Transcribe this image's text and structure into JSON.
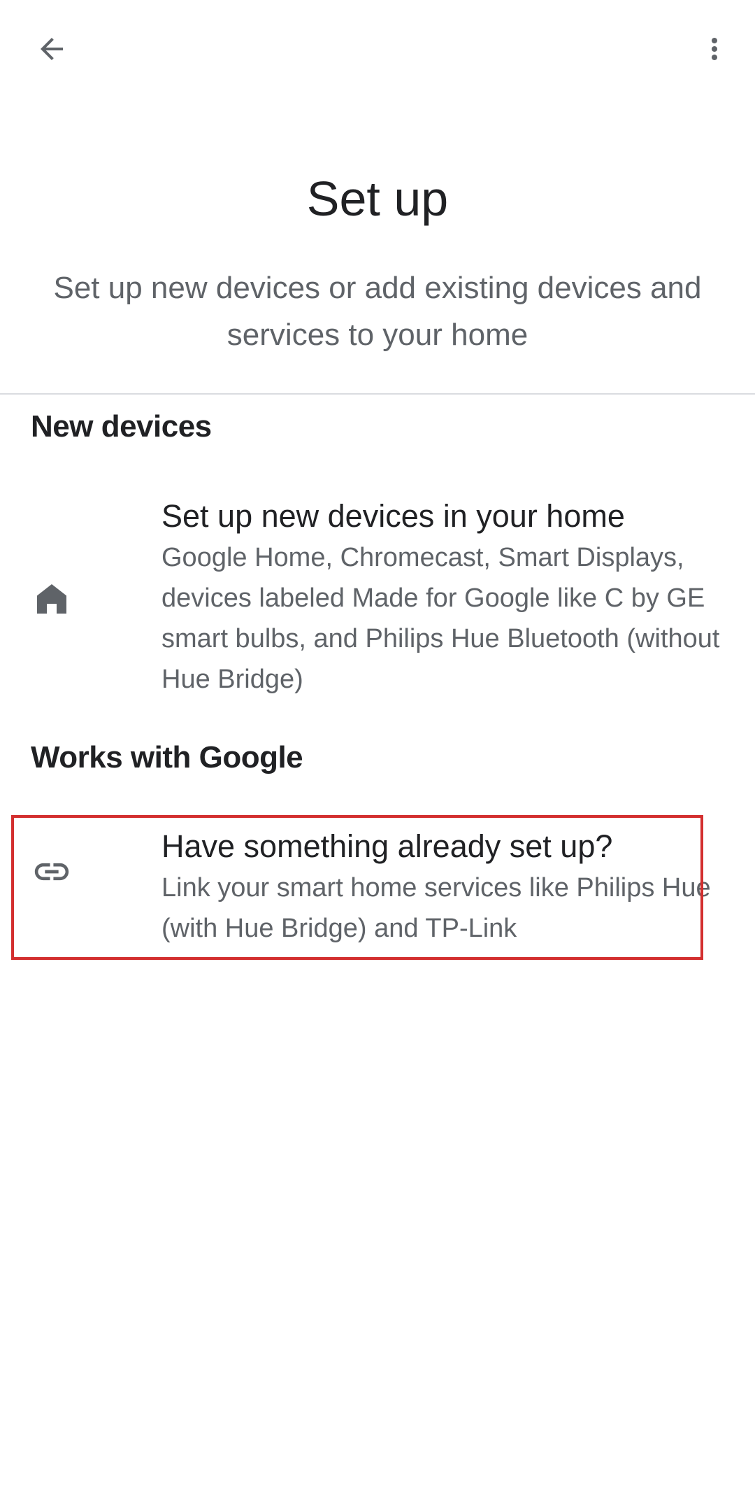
{
  "header": {
    "back_icon": "arrow-back-icon",
    "more_icon": "more-vert-icon"
  },
  "hero": {
    "title": "Set up",
    "subtitle": "Set up new devices or add existing devices and services to your home"
  },
  "sections": {
    "new_devices": {
      "heading": "New devices",
      "item": {
        "icon": "home-icon",
        "title": "Set up new devices in your home",
        "description": "Google Home, Chromecast, Smart Displays, devices labeled Made for Google like C by GE smart bulbs, and Philips Hue Bluetooth (without Hue Bridge)"
      }
    },
    "works_with_google": {
      "heading": "Works with Google",
      "item": {
        "icon": "link-icon",
        "title": "Have something already set up?",
        "description": "Link your smart home services like Philips Hue (with Hue Bridge) and TP-Link"
      }
    }
  },
  "colors": {
    "primary_text": "#202124",
    "secondary_text": "#5f6368",
    "icon": "#5f6368",
    "divider": "#dadce0",
    "highlight": "#d32f2f"
  }
}
